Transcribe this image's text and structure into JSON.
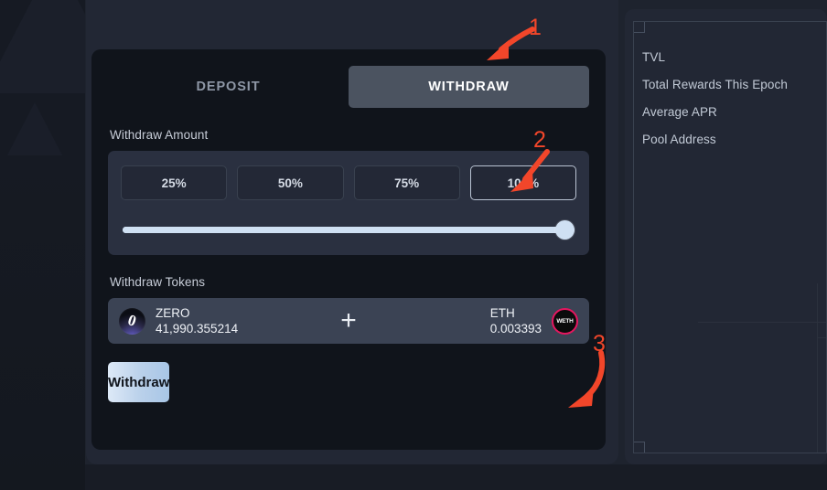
{
  "tabs": [
    {
      "label": "DEPOSIT",
      "active": false
    },
    {
      "label": "WITHDRAW",
      "active": true
    }
  ],
  "withdraw_amount": {
    "label": "Withdraw Amount",
    "percent_options": [
      "25%",
      "50%",
      "75%",
      "100%"
    ],
    "selected_percent": "100%",
    "slider_value": 100
  },
  "withdraw_tokens": {
    "label": "Withdraw Tokens",
    "operator": "+",
    "tokens": [
      {
        "symbol": "ZERO",
        "amount": "41,990.355214",
        "icon": "zero-token-icon",
        "icon_glyph": "0"
      },
      {
        "symbol": "ETH",
        "amount": "0.003393",
        "icon": "weth-token-icon",
        "icon_glyph": "WETH"
      }
    ]
  },
  "submit": {
    "label": "Withdraw"
  },
  "stats": {
    "rows": [
      {
        "label": "TVL"
      },
      {
        "label": "Total Rewards This Epoch"
      },
      {
        "label": "Average APR"
      },
      {
        "label": "Pool Address"
      }
    ]
  },
  "annotations": [
    {
      "number": "1",
      "target": "withdraw-tab",
      "style": "curved-arrow"
    },
    {
      "number": "2",
      "target": "percent-100-button",
      "style": "straight-arrow"
    },
    {
      "number": "3",
      "target": "withdraw-submit-button",
      "style": "curved-arrow"
    }
  ],
  "colors": {
    "accent_annotation": "#f2462a",
    "active_tab_bg": "#4b5360",
    "slider_fill": "#cfe0f3",
    "submit_gradient_start": "#dde9f7",
    "submit_gradient_end": "#a8c6e6",
    "card_bg": "#10141b",
    "panel_bg": "#222734"
  }
}
